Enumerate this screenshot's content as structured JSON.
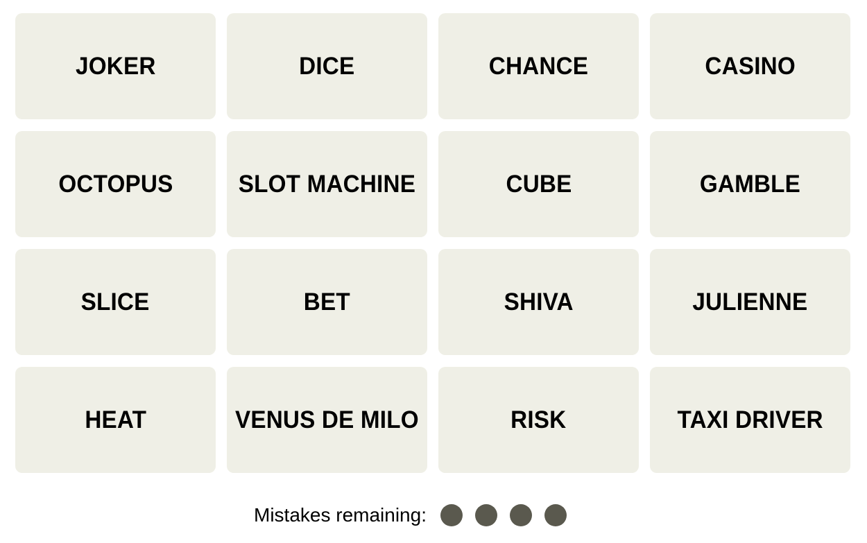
{
  "board": {
    "tiles": [
      "JOKER",
      "DICE",
      "CHANCE",
      "CASINO",
      "OCTOPUS",
      "SLOT MACHINE",
      "CUBE",
      "GAMBLE",
      "SLICE",
      "BET",
      "SHIVA",
      "JULIENNE",
      "HEAT",
      "VENUS DE MILO",
      "RISK",
      "TAXI DRIVER"
    ]
  },
  "status": {
    "mistakes_label": "Mistakes remaining:",
    "mistakes_remaining": 4,
    "dot_color": "#5a594e"
  },
  "colors": {
    "tile_background": "#efefe6",
    "text": "#000000"
  }
}
